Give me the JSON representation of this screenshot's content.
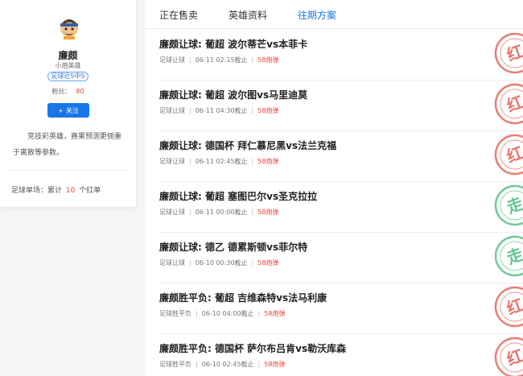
{
  "profile": {
    "name": "廉颇",
    "title": "小炮英雄",
    "badge": "足球近5中5",
    "fans_label": "粉丝：",
    "fans_count": "80",
    "follow_label": "关注",
    "follow_icon": "+",
    "description": "竞技彩英雄，赛果预测更侧重于离散等参数。",
    "record_prefix": "足球单场：累计",
    "record_count": "10",
    "record_suffix": "个红单"
  },
  "tabs": [
    "正在售卖",
    "英雄资料",
    "往期方案"
  ],
  "active_tab": 2,
  "colors": {
    "accent": "#1677e8",
    "red": "#e5423a",
    "win_stamp": "#e0524a",
    "draw_stamp": "#3cb878"
  },
  "plans": [
    {
      "title": "廉颇让球: 葡超 波尔蒂芒vs本菲卡",
      "type": "足球让球",
      "time": "06-11 02:15截止",
      "price": "58炮弹",
      "result": "红",
      "stamp_icon": "red-win-stamp-icon"
    },
    {
      "title": "廉颇让球: 葡超 波尔图vs马里迪莫",
      "type": "足球让球",
      "time": "06-11 04:30截止",
      "price": "58炮弹",
      "result": "红",
      "stamp_icon": "red-win-stamp-icon"
    },
    {
      "title": "廉颇让球: 德国杯 拜仁慕尼黑vs法兰克福",
      "type": "足球让球",
      "time": "06-11 02:45截止",
      "price": "58炮弹",
      "result": "红",
      "stamp_icon": "red-win-stamp-icon"
    },
    {
      "title": "廉颇让球: 葡超 塞图巴尔vs圣克拉拉",
      "type": "足球让球",
      "time": "06-11 00:00截止",
      "price": "58炮弹",
      "result": "走",
      "stamp_icon": "push-stamp-icon"
    },
    {
      "title": "廉颇让球: 德乙 德累斯顿vs菲尔特",
      "type": "足球让球",
      "time": "06-10 00:30截止",
      "price": "58炮弹",
      "result": "走",
      "stamp_icon": "push-stamp-icon"
    },
    {
      "title": "廉颇胜平负: 葡超 吉维森特vs法马利康",
      "type": "足球胜平负",
      "time": "06-10 04:00截止",
      "price": "58炮弹",
      "result": "红",
      "stamp_icon": "red-win-stamp-icon"
    },
    {
      "title": "廉颇胜平负: 德国杯 萨尔布吕肯vs勒沃库森",
      "type": "足球胜平负",
      "time": "06-10 02:45截止",
      "price": "58炮弹",
      "result": "红",
      "stamp_icon": "red-win-stamp-icon"
    }
  ]
}
